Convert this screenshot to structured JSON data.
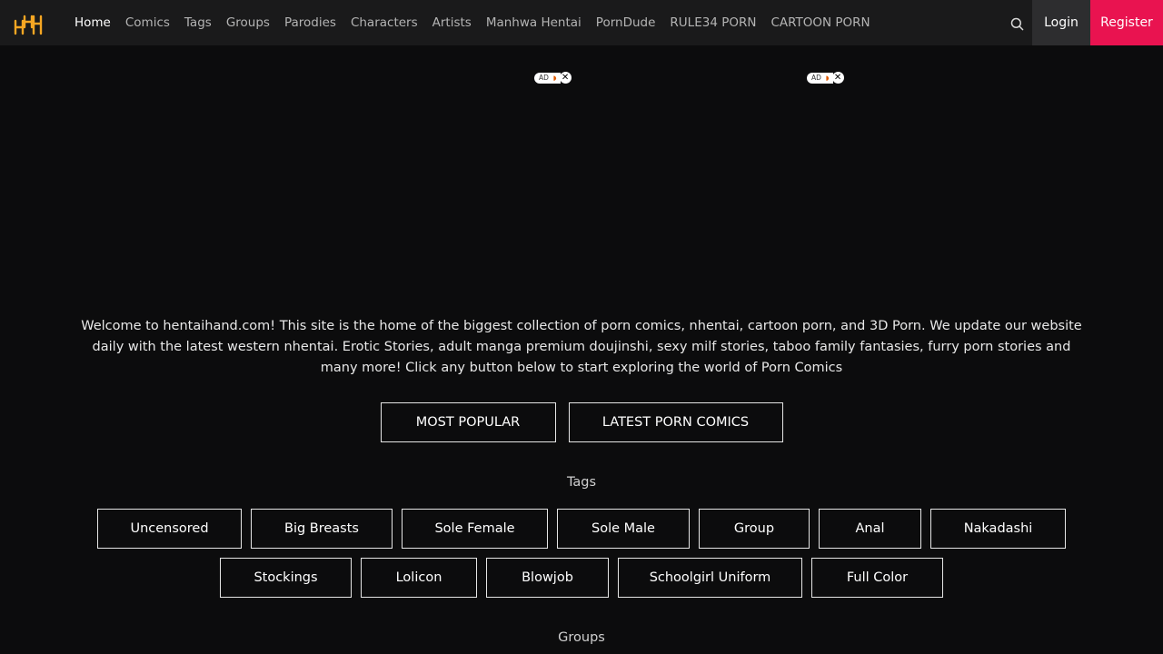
{
  "header": {
    "nav": [
      "Home",
      "Comics",
      "Tags",
      "Groups",
      "Parodies",
      "Characters",
      "Artists",
      "Manhwa Hentai",
      "PornDude",
      "RULE34 PORN",
      "CARTOON PORN"
    ],
    "active_index": 0,
    "search_icon": "search-icon",
    "login_label": "Login",
    "register_label": "Register",
    "accent_color": "#e91350",
    "logo_color": "#f5a623"
  },
  "ads": [
    {
      "label": "AD",
      "close": "✕"
    },
    {
      "label": "AD",
      "close": "✕"
    }
  ],
  "welcome": {
    "text": "Welcome to hentaihand.com! This site is the home of the biggest collection of porn comics, nhentai, cartoon porn, and 3D Porn. We update our website daily with the latest western nhentai. Erotic Stories, adult manga premium doujinshi, sexy milf stories, taboo family fantasies, furry porn stories and many more! Click any button below to start exploring the world of Porn Comics"
  },
  "cta": {
    "most_popular": "MOST POPULAR",
    "latest": "LATEST PORN COMICS"
  },
  "tags": {
    "title": "Tags",
    "row1": [
      "Uncensored",
      "Big Breasts",
      "Sole Female",
      "Sole Male",
      "Group",
      "Anal",
      "Nakadashi"
    ],
    "row2": [
      "Stockings",
      "Lolicon",
      "Blowjob",
      "Schoolgirl Uniform",
      "Full Color"
    ]
  },
  "groups": {
    "title": "Groups"
  }
}
